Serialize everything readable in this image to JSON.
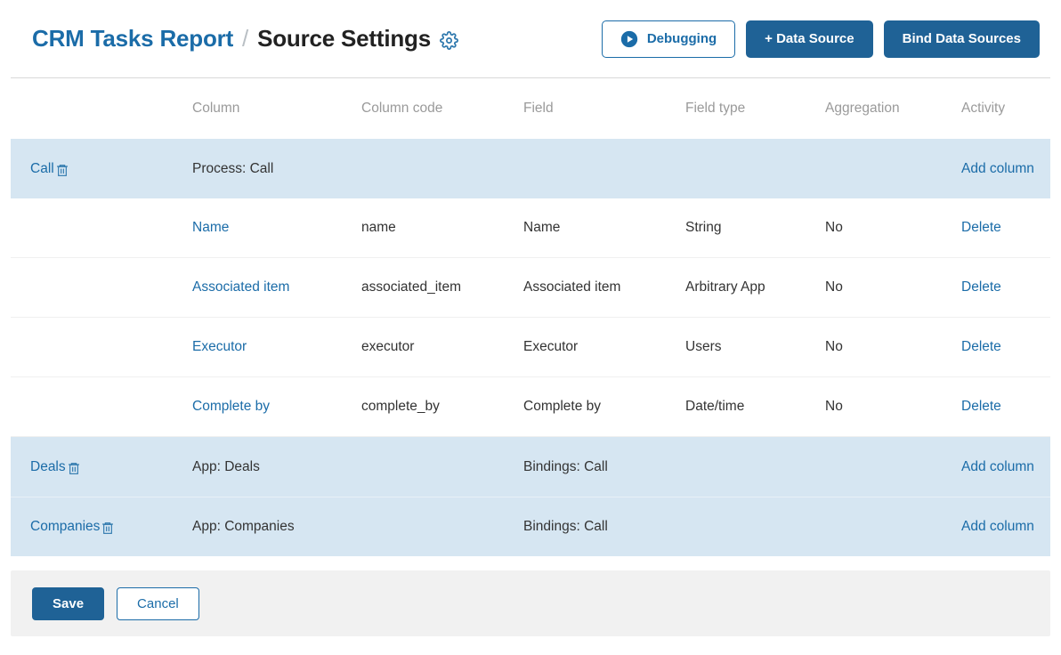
{
  "header": {
    "breadcrumb": {
      "parent": "CRM Tasks Report",
      "separator": "/",
      "current": "Source Settings",
      "settings_icon": "gear-icon"
    },
    "actions": [
      {
        "label": "Debugging",
        "style": "outline",
        "icon": "play-circle-icon"
      },
      {
        "label": "+ Data Source",
        "style": "primary",
        "icon": ""
      },
      {
        "label": "Bind Data Sources",
        "style": "primary",
        "icon": ""
      }
    ]
  },
  "table": {
    "columns": [
      "Column",
      "Column code",
      "Field",
      "Field type",
      "Aggregation",
      "Activity"
    ],
    "groups": [
      {
        "name": "Call",
        "delete_icon": "trash-icon",
        "column": "Process: Call",
        "field": "",
        "activity": "Add column",
        "rows": [
          {
            "column": "Name",
            "code": "name",
            "field": "Name",
            "field_type": "String",
            "aggregation": "No",
            "activity": "Delete"
          },
          {
            "column": "Associated item",
            "code": "associated_item",
            "field": "Associated item",
            "field_type": "Arbitrary App",
            "aggregation": "No",
            "activity": "Delete"
          },
          {
            "column": "Executor",
            "code": "executor",
            "field": "Executor",
            "field_type": "Users",
            "aggregation": "No",
            "activity": "Delete"
          },
          {
            "column": "Complete by",
            "code": "complete_by",
            "field": "Complete by",
            "field_type": "Date/time",
            "aggregation": "No",
            "activity": "Delete"
          }
        ]
      },
      {
        "name": "Deals",
        "delete_icon": "trash-icon",
        "column": "App: Deals",
        "field": "Bindings: Call",
        "activity": "Add column",
        "rows": []
      },
      {
        "name": "Companies",
        "delete_icon": "trash-icon",
        "column": "App: Companies",
        "field": "Bindings: Call",
        "activity": "Add column",
        "rows": []
      }
    ]
  },
  "footer": {
    "save_label": "Save",
    "cancel_label": "Cancel"
  },
  "colors": {
    "accent": "#1b6ca8",
    "primary_button": "#1f6296",
    "group_row": "#d6e6f2",
    "footer_bar": "#f1f1f1",
    "header_text": "#9a9a9a"
  }
}
